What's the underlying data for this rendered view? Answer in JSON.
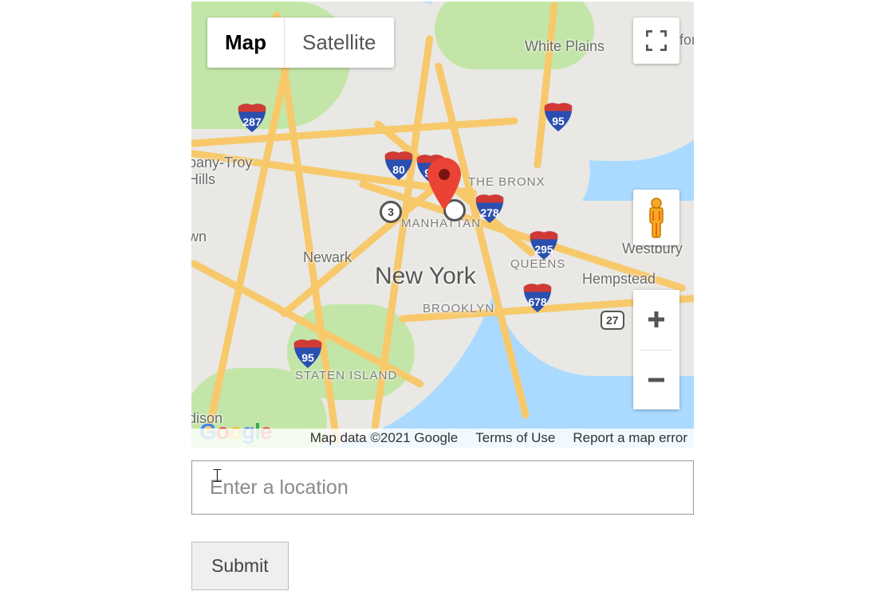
{
  "controls": {
    "map_tab": "Map",
    "satellite_tab": "Satellite"
  },
  "map": {
    "center_label": "New York",
    "districts": {
      "manhattan": "MANHATTAN",
      "bronx": "THE BRONX",
      "queens": "QUEENS",
      "brooklyn": "BROOKLYN",
      "staten": "STATEN ISLAND"
    },
    "cities": {
      "newark": "Newark",
      "white_plains": "White Plains",
      "hempstead": "Hempstead",
      "westbury": "Westbury",
      "parsippany": "pany-Troy\nHills",
      "edison": "dison",
      "town": "wn",
      "for": "for"
    },
    "routes": {
      "r3": "3",
      "r27": "27"
    },
    "interstates": {
      "i95a": "95",
      "i95b": "95",
      "i95c": "95",
      "i80": "80",
      "i287": "287",
      "i278": "278",
      "i295": "295",
      "i678": "678"
    }
  },
  "credits": {
    "data": "Map data ©2021 Google",
    "terms": "Terms of Use",
    "report": "Report a map error"
  },
  "google_letters": [
    "G",
    "o",
    "o",
    "g",
    "l",
    "e"
  ],
  "form": {
    "placeholder": "Enter a location",
    "submit": "Submit"
  }
}
